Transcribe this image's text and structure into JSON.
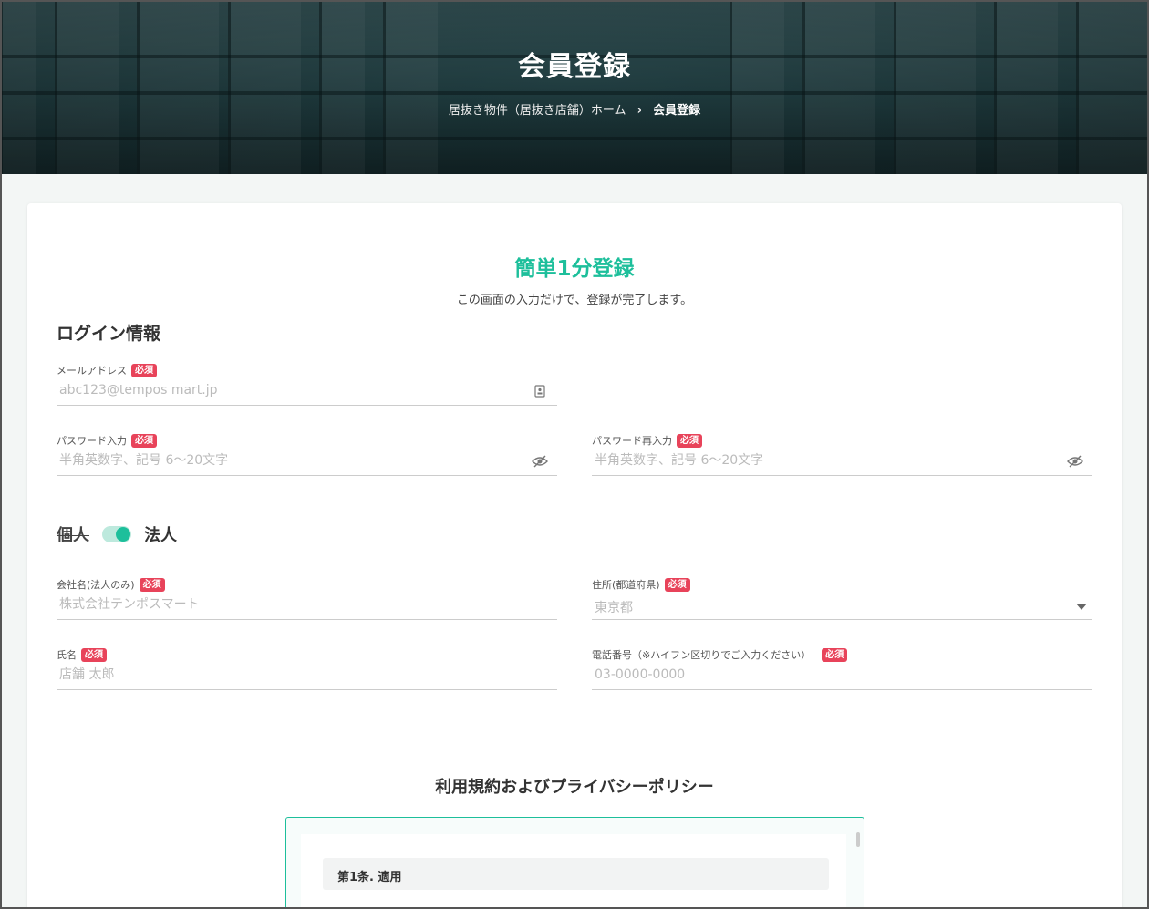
{
  "hero": {
    "title": "会員登録",
    "breadcrumb": {
      "home": "居抜き物件（居抜き店舗）ホーム",
      "separator": "›",
      "current": "会員登録"
    }
  },
  "form": {
    "title": "簡単1分登録",
    "subtitle": "この画面の入力だけで、登録が完了します。",
    "login_section_title": "ログイン情報",
    "required_badge": "必須",
    "accent_color": "#1dbf9b",
    "badge_color": "#e8435a",
    "email": {
      "label": "メールアドレス",
      "placeholder": "abc123@tempos mart.jp"
    },
    "password": {
      "label": "パスワード入力",
      "placeholder": "半角英数字、記号 6〜20文字"
    },
    "password_confirm": {
      "label": "パスワード再入力",
      "placeholder": "半角英数字、記号 6〜20文字"
    },
    "entity_toggle": {
      "individual": "個人",
      "corporate": "法人",
      "selected": "法人"
    },
    "company": {
      "label": "会社名(法人のみ)",
      "placeholder": "株式会社テンポスマート"
    },
    "prefecture": {
      "label": "住所(都道府県)",
      "value": "東京都"
    },
    "name": {
      "label": "氏名",
      "placeholder": "店舗 太郎"
    },
    "phone": {
      "label": "電話番号（※ハイフン区切りでご入力ください）",
      "placeholder": "03-0000-0000"
    }
  },
  "terms": {
    "title": "利用規約およびプライバシーポリシー",
    "first_article": "第1条. 適用"
  }
}
